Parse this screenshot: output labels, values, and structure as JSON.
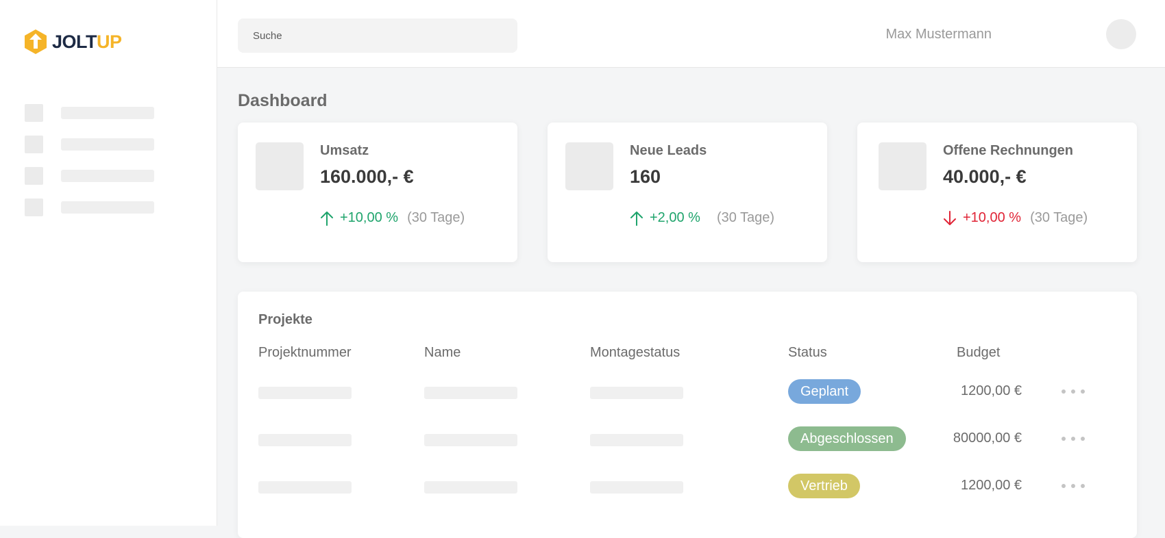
{
  "brand": {
    "part1": "JOLT",
    "part2": "UP",
    "primary": "#1d2a44",
    "accent": "#f5b428"
  },
  "sidebar": {
    "items": [
      {
        "icon": "placeholder-icon"
      },
      {
        "icon": "placeholder-icon"
      },
      {
        "icon": "placeholder-icon"
      },
      {
        "icon": "placeholder-icon"
      }
    ]
  },
  "header": {
    "search_placeholder": "Suche",
    "username": "Max Mustermann"
  },
  "page": {
    "title": "Dashboard"
  },
  "kpis": [
    {
      "label": "Umsatz",
      "value": "160.000,- €",
      "change": "+10,00 %",
      "direction": "up",
      "period": "(30 Tage)",
      "color": "#1fa46c"
    },
    {
      "label": "Neue Leads",
      "value": "160",
      "change": "+2,00 %",
      "direction": "up",
      "period": "(30 Tage)",
      "color": "#1fa46c"
    },
    {
      "label": "Offene Rechnungen",
      "value": "40.000,- €",
      "change": "+10,00 %",
      "direction": "down",
      "period": "(30 Tage)",
      "color": "#e02436"
    }
  ],
  "projects": {
    "title": "Projekte",
    "columns": [
      "Projektnummer",
      "Name",
      "Montagestatus",
      "Status",
      "Budget"
    ],
    "rows": [
      {
        "status": "Geplant",
        "status_color": "#78a8dc",
        "budget": "1200,00 €"
      },
      {
        "status": "Abgeschlossen",
        "status_color": "#8dbb8f",
        "budget": "80000,00 €"
      },
      {
        "status": "Vertrieb",
        "status_color": "#d2c766",
        "budget": "1200,00 €"
      }
    ]
  }
}
